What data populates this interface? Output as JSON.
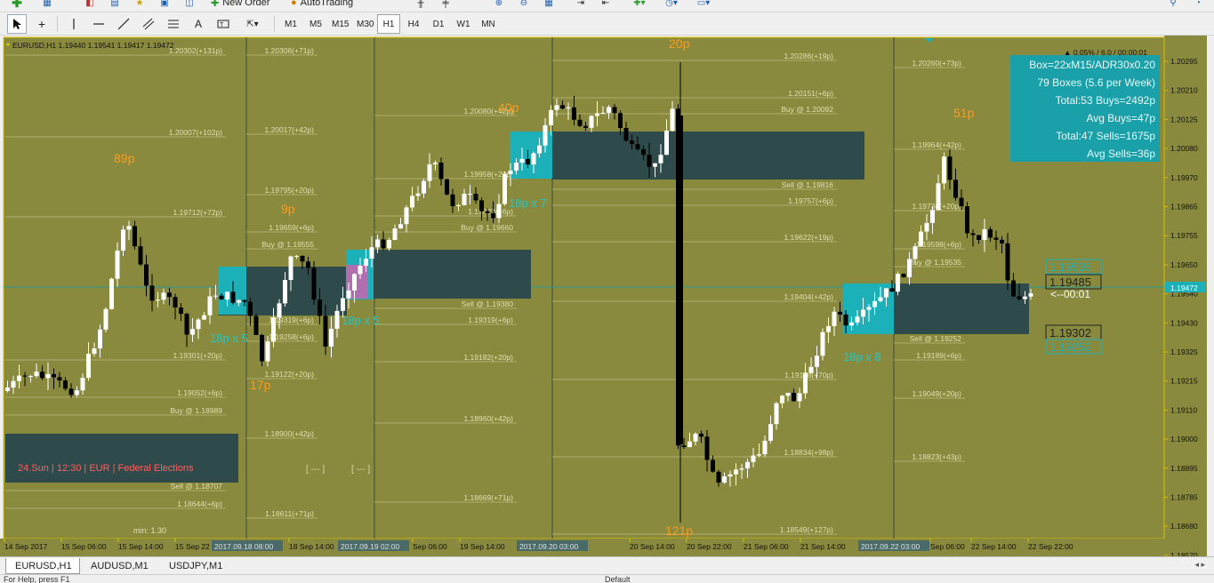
{
  "toolbar_top": {
    "new_order_label": "New Order",
    "auto_trading_label": "AutoTrading"
  },
  "timeframes": [
    "M1",
    "M5",
    "M15",
    "M30",
    "H1",
    "H4",
    "D1",
    "W1",
    "MN"
  ],
  "active_timeframe": "H1",
  "chart": {
    "symbol_header": "EURUSD,H1  1.19440 1.19541 1.19417 1.19472",
    "spread_info": "▲ 0.05% / 6.0 / 00:00:01",
    "background": "#8a8a3e",
    "price_axis": [
      "1.20295",
      "1.20210",
      "1.20125",
      "1.20080",
      "1.19970",
      "1.19865",
      "1.19755",
      "1.19650",
      "1.19540",
      "1.19430",
      "1.19325",
      "1.19215",
      "1.19110",
      "1.19000",
      "1.18895",
      "1.18785",
      "1.18680",
      "1.18570"
    ],
    "current_price": "1.19472",
    "time_axis": [
      "14 Sep 2017",
      "15 Sep 06:00",
      "15 Sep 14:00",
      "15 Sep 22",
      "18 Sep 14:00",
      "Sep 06:00",
      "19 Sep 14:00",
      "20 Sep 14:00",
      "20 Sep 22:00",
      "21 Sep 06:00",
      "21 Sep 14:00",
      "Sep 06:00",
      "22 Sep 14:00",
      "22 Sep 22:00"
    ],
    "time_markers": [
      "2017.09.18 08:00",
      "2017.09.19 02:00",
      "2017.09.20 03:00",
      "2017.09.22 03:00"
    ],
    "info_box": [
      "Box=22xM15/ADR30x0.20",
      "79 Boxes (5.6 per Week)",
      "Total:53 Buys=2492p",
      "Avg Buys=47p",
      "Total:47 Sells=1675p",
      "Avg Sells=36p"
    ],
    "pip_labels": [
      "89p",
      "9p",
      "17p",
      "40p",
      "20p",
      "121p",
      "51p"
    ],
    "box_labels": [
      "18p x 5",
      "18p x 5",
      "18p x 7",
      "18p x 8"
    ],
    "level_labels": {
      "col1": [
        "1.20302(+131p)",
        "1.20007(+102p)",
        "1.19712(+72p)",
        "1.19301(+20p)",
        "1.19052(+6p)",
        "Buy @ 1.18989",
        "Sell @ 1.18707",
        "1.18644(+6p)"
      ],
      "col2": [
        "1.20306(+71p)",
        "1.20017(+42p)",
        "1.19795(+20p)",
        "1.19659(+6p)",
        "Buy @ 1.19555",
        "1.19319(+6p)",
        "1.19258(+6p)",
        "1.19122(+20p)",
        "1.18900(+42p)",
        "1.18611(+71p)"
      ],
      "col3": [
        "1.20080(+42p)",
        "1.19958(+20p)",
        "1.19822(+6p)",
        "Buy @ 1.19660",
        "Sell @ 1.19380",
        "1.19319(+6p)",
        "1.19182(+20p)",
        "1.18960(+42p)",
        "1.18669(+71p)"
      ],
      "col4": [
        "1.20286(+19p)",
        "1.20151(+6p)",
        "Buy @ 1.20092",
        "Sell @ 1.19816",
        "1.19757(+6p)",
        "1.19622(+19p)",
        "1.19404(+42p)",
        "1.19118(+70p)",
        "1.18834(+98p)",
        "1.18549(+127p)"
      ],
      "col5": [
        "1.20260(+73p)",
        "1.19964(+42p)",
        "1.19738(+20p)",
        "1.19598(+6p)",
        "Buy @ 1.19535",
        "Sell @ 1.19252",
        "1.19189(+6p)",
        "1.19049(+20p)",
        "1.18823(+43p)"
      ]
    },
    "right_price_boxes": [
      "1.19535",
      "1.19485",
      "1.19302",
      "1.19252"
    ],
    "countdown": "<--00:01",
    "news_event": "24.Sun  |  12:30  |  EUR  |  Federal Elections",
    "min_label": "min:   1.30",
    "bracket_labels": [
      "[ --- ]",
      "[ --- ]"
    ]
  },
  "tabs": [
    "EURUSD,H1",
    "AUDUSD,M1",
    "USDJPY,M1"
  ],
  "active_tab": "EURUSD,H1",
  "status_bar": [
    "For Help, press F1",
    "Default"
  ]
}
